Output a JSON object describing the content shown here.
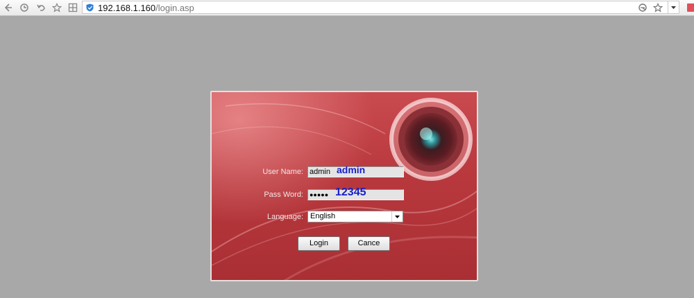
{
  "browser": {
    "url_host": "192.168.1.160",
    "url_path": "/login.asp",
    "icons": [
      "back-icon",
      "reload-icon",
      "undo-icon",
      "star-icon",
      "grid-icon",
      "shield-icon",
      "compat-icon",
      "bookmark-star-icon",
      "dropdown-icon"
    ]
  },
  "login": {
    "username_label": "User Name:",
    "username_value": "admin",
    "username_note": "admin",
    "password_label": "Pass Word:",
    "password_masked": "●●●●●",
    "password_note": "12345",
    "language_label": "Language:",
    "language_value": "English",
    "login_button": "Login",
    "cancel_button": "Cance"
  },
  "colors": {
    "page_bg": "#a8a8a8",
    "panel_red": "#b8383d",
    "note_blue": "#1520c8"
  }
}
